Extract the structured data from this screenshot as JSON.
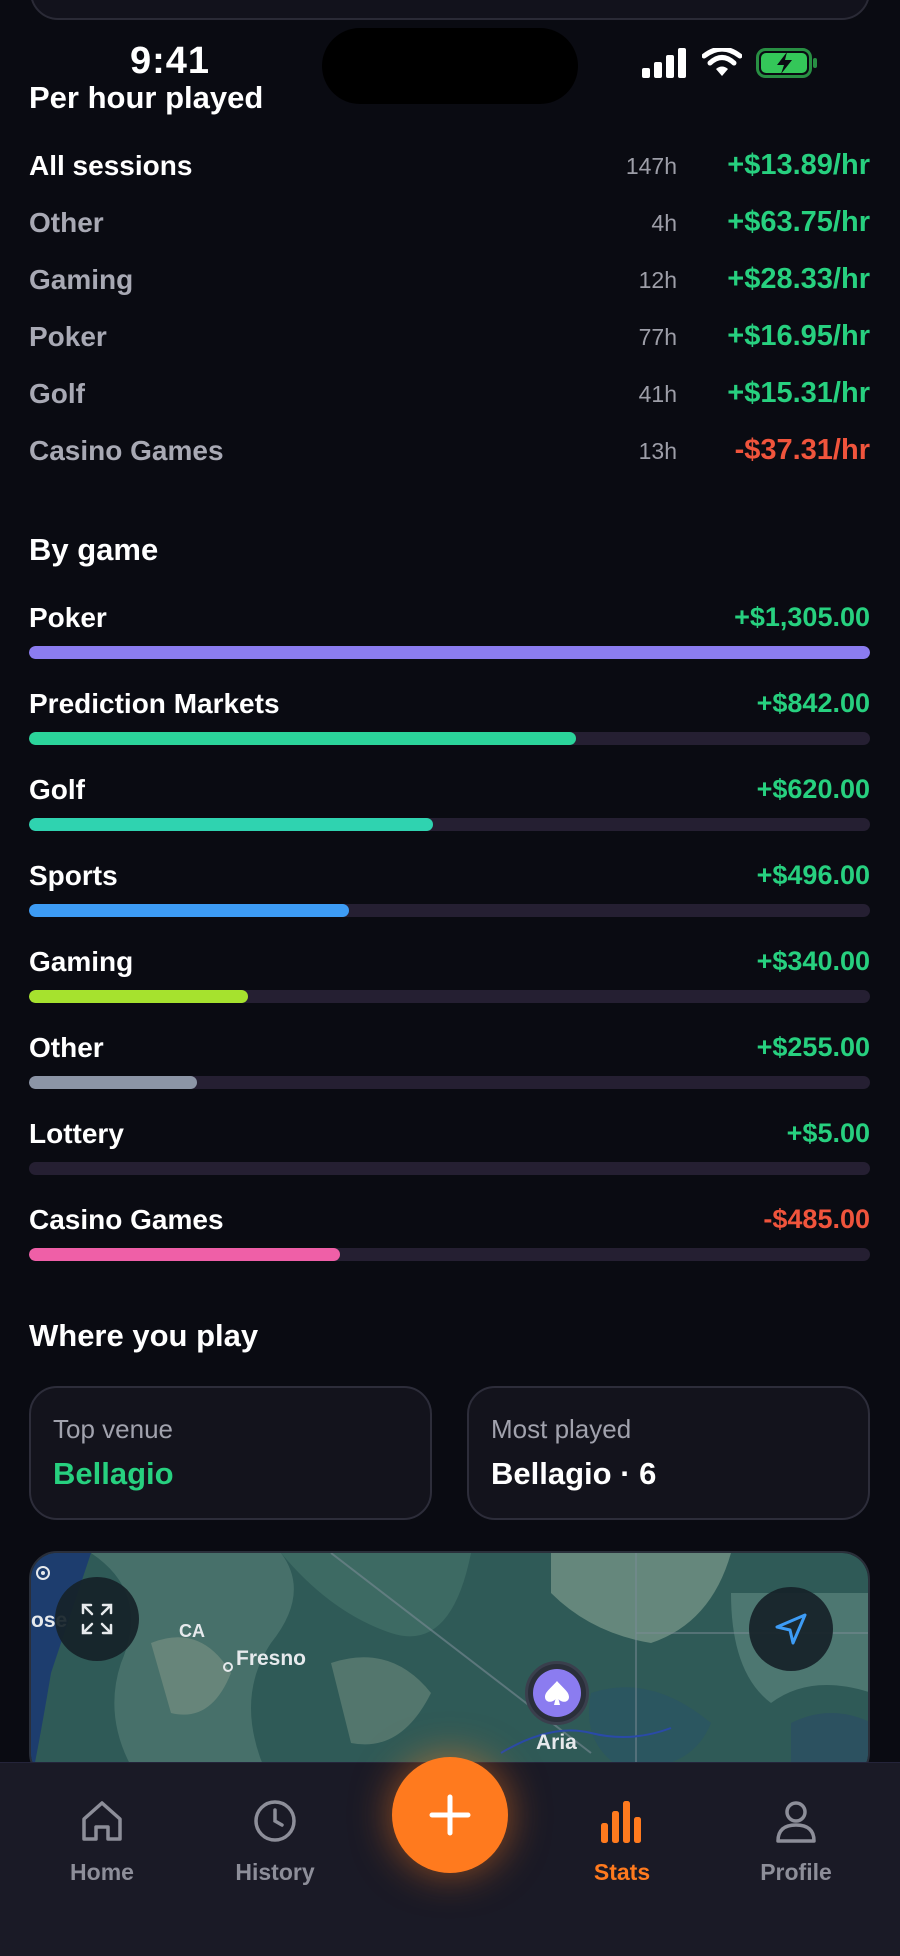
{
  "status_bar": {
    "time": "9:41"
  },
  "per_hour": {
    "title": "Per hour played",
    "rows": [
      {
        "name": "All sessions",
        "hours": "147h",
        "rate": "+$13.89/hr"
      },
      {
        "name": "Other",
        "hours": "4h",
        "rate": "+$63.75/hr"
      },
      {
        "name": "Gaming",
        "hours": "12h",
        "rate": "+$28.33/hr"
      },
      {
        "name": "Poker",
        "hours": "77h",
        "rate": "+$16.95/hr"
      },
      {
        "name": "Golf",
        "hours": "41h",
        "rate": "+$15.31/hr"
      },
      {
        "name": "Casino Games",
        "hours": "13h",
        "rate": "-$37.31/hr"
      }
    ]
  },
  "by_game": {
    "title": "By game",
    "rows": [
      {
        "name": "Poker",
        "amount": "+$1,305.00",
        "bar_fraction": 1.0,
        "color": "#8b7cf0"
      },
      {
        "name": "Prediction Markets",
        "amount": "+$842.00",
        "bar_fraction": 0.65,
        "color": "#2bd49a"
      },
      {
        "name": "Golf",
        "amount": "+$620.00",
        "bar_fraction": 0.48,
        "color": "#2fd3b0"
      },
      {
        "name": "Sports",
        "amount": "+$496.00",
        "bar_fraction": 0.38,
        "color": "#3d9cf5"
      },
      {
        "name": "Gaming",
        "amount": "+$340.00",
        "bar_fraction": 0.26,
        "color": "#a6e22e"
      },
      {
        "name": "Other",
        "amount": "+$255.00",
        "bar_fraction": 0.2,
        "color": "#8c95a6"
      },
      {
        "name": "Lottery",
        "amount": "+$5.00",
        "bar_fraction": 0.0,
        "color": "#8c95a6"
      },
      {
        "name": "Casino Games",
        "amount": "-$485.00",
        "bar_fraction": 0.37,
        "color": "#ef5fa7"
      }
    ]
  },
  "where": {
    "title": "Where you play",
    "top_venue": {
      "label": "Top venue",
      "value": "Bellagio"
    },
    "most_played": {
      "label": "Most played",
      "value": "Bellagio · 6"
    }
  },
  "map": {
    "labels": {
      "ose": "ose",
      "ca": "CA",
      "fresno": "Fresno",
      "aria": "Aria"
    }
  },
  "nav": {
    "home": "Home",
    "history": "History",
    "stats": "Stats",
    "profile": "Profile"
  },
  "colors": {
    "accent": "#ff7a1e",
    "positive": "#27d07f",
    "negative": "#f0543c"
  }
}
